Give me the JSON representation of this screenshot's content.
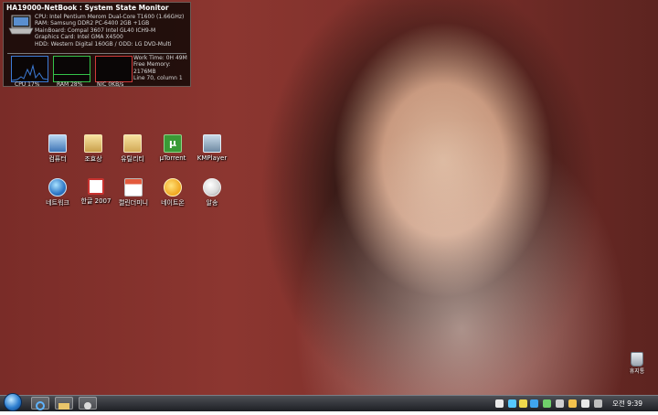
{
  "monitor": {
    "title": "HA19000-NetBook : System State Monitor",
    "cpu": "CPU:  Intel Pentium Merom Dual-Core T1600 (1.66GHz)",
    "ram": "RAM:  Samsung DDR2 PC-6400 2GB +1GB",
    "mainboard": "MainBoard: Compal 3607 Intel GL40 ICH9-M",
    "graphics": "Graphics Card:  Intel GMA X4500",
    "hdd": "HDD:  Western Digital 160GB  /  ODD:  LG DVD-Multi",
    "cpu_label": "CPU 17%",
    "ram_label": "RAM 28%",
    "nic_label": "NIC 0KB/s",
    "cpu_percent": 17,
    "ram_percent": 28,
    "work_time": "Work Time:  0H 49M",
    "free_memory": "Free Memory: 2176MB",
    "line_col": "Line 70, column 1",
    "colors": {
      "cpu": "#3c7bd6",
      "ram": "#34c24a",
      "nic": "#d03a3a"
    }
  },
  "desktop_icons": [
    {
      "label": "컴퓨터",
      "icon": "computer-icon"
    },
    {
      "label": "조효상",
      "icon": "user-folder-icon"
    },
    {
      "label": "유틸리티",
      "icon": "folder-icon"
    },
    {
      "label": "µTorrent",
      "icon": "utorrent-icon"
    },
    {
      "label": "KMPlayer",
      "icon": "kmplayer-icon"
    },
    {
      "label": "네트워크",
      "icon": "network-icon"
    },
    {
      "label": "한글 2007",
      "icon": "hangul-icon"
    },
    {
      "label": "캘린더미니",
      "icon": "calendar-icon"
    },
    {
      "label": "네이트온",
      "icon": "nateon-icon"
    },
    {
      "label": "알송",
      "icon": "alsong-icon"
    }
  ],
  "recycle_bin": {
    "label": "휴지통",
    "icon": "recycle-bin-icon"
  },
  "taskbar": {
    "clock": "오전 9:39",
    "quick_launch": [
      "internet-explorer-icon",
      "folder-icon",
      "media-icon"
    ]
  }
}
